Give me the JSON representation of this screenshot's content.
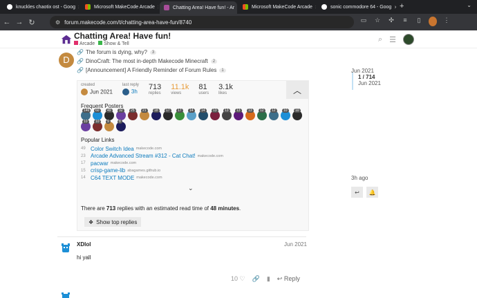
{
  "browser": {
    "tabs": [
      {
        "title": "knuckles chaotix ost - Goog",
        "fav": "#ffffff"
      },
      {
        "title": "Microsoft MakeCode Arcade",
        "fav": "#f25022"
      },
      {
        "title": "Chatting Area! Have fun! - Ar",
        "fav": "#a84d9a"
      },
      {
        "title": "Microsoft MakeCode Arcade",
        "fav": "#f25022"
      },
      {
        "title": "sonic commodore 64 - Goog",
        "fav": "#ffffff"
      }
    ],
    "url": "forum.makecode.com/t/chatting-area-have-fun/8740"
  },
  "header": {
    "title": "Chatting Area! Have fun!",
    "categories": [
      {
        "name": "Arcade",
        "color": "#e1306c"
      },
      {
        "name": "Show & Tell",
        "color": "#3ab54a"
      }
    ]
  },
  "links": [
    {
      "text": "The forum is dying, why?",
      "count": "3"
    },
    {
      "text": "DinoCraft: The most in-depth Makecode Minecraft",
      "count": "2"
    },
    {
      "text": "[Announcement] A Friendly Reminder of Forum Rules",
      "count": "1"
    }
  ],
  "post_avatar_letter": "D",
  "summary": {
    "created_label": "created",
    "created_value": "Jun 2021",
    "last_label": "last reply",
    "last_value": "3h",
    "replies": "713",
    "replies_label": "replies",
    "views": "11.1k",
    "views_label": "views",
    "users": "81",
    "users_label": "users",
    "likes": "3.1k",
    "likes_label": "likes",
    "frequent_title": "Frequent Posters",
    "popular_title": "Popular Links",
    "poster_badges": [
      "146",
      "60",
      "49",
      "32",
      "25",
      "21",
      "18",
      "17",
      "17",
      "14",
      "14",
      "13",
      "13",
      "13",
      "13",
      "12",
      "12",
      "10",
      "10",
      "10",
      "10",
      "9",
      "8"
    ],
    "popular_links": [
      {
        "n": "49",
        "t": "Color Switch Idea",
        "d": "makecode.com"
      },
      {
        "n": "23",
        "t": "Arcade Advanced Stream #312 - Cat Chat!",
        "d": "makecode.com"
      },
      {
        "n": "17",
        "t": "pacwar",
        "d": "makecode.com"
      },
      {
        "n": "15",
        "t": "crisp-game-lib",
        "d": "abagames.github.io"
      },
      {
        "n": "14",
        "t": "C64 TEXT MODE",
        "d": "makecode.com"
      }
    ],
    "read_prefix": "There are ",
    "read_replies": "713",
    "read_middle": " replies with an estimated read time of ",
    "read_time": "48 minutes",
    "read_suffix": ".",
    "show_top": "Show top replies"
  },
  "timeline": {
    "start": "Jun 2021",
    "position": "1 / 714",
    "position_date": "Jun 2021",
    "end": "3h ago"
  },
  "post2": {
    "user": "XDlol",
    "date": "Jun 2021",
    "body": "hi yall",
    "likes": "10",
    "reply": "Reply"
  }
}
